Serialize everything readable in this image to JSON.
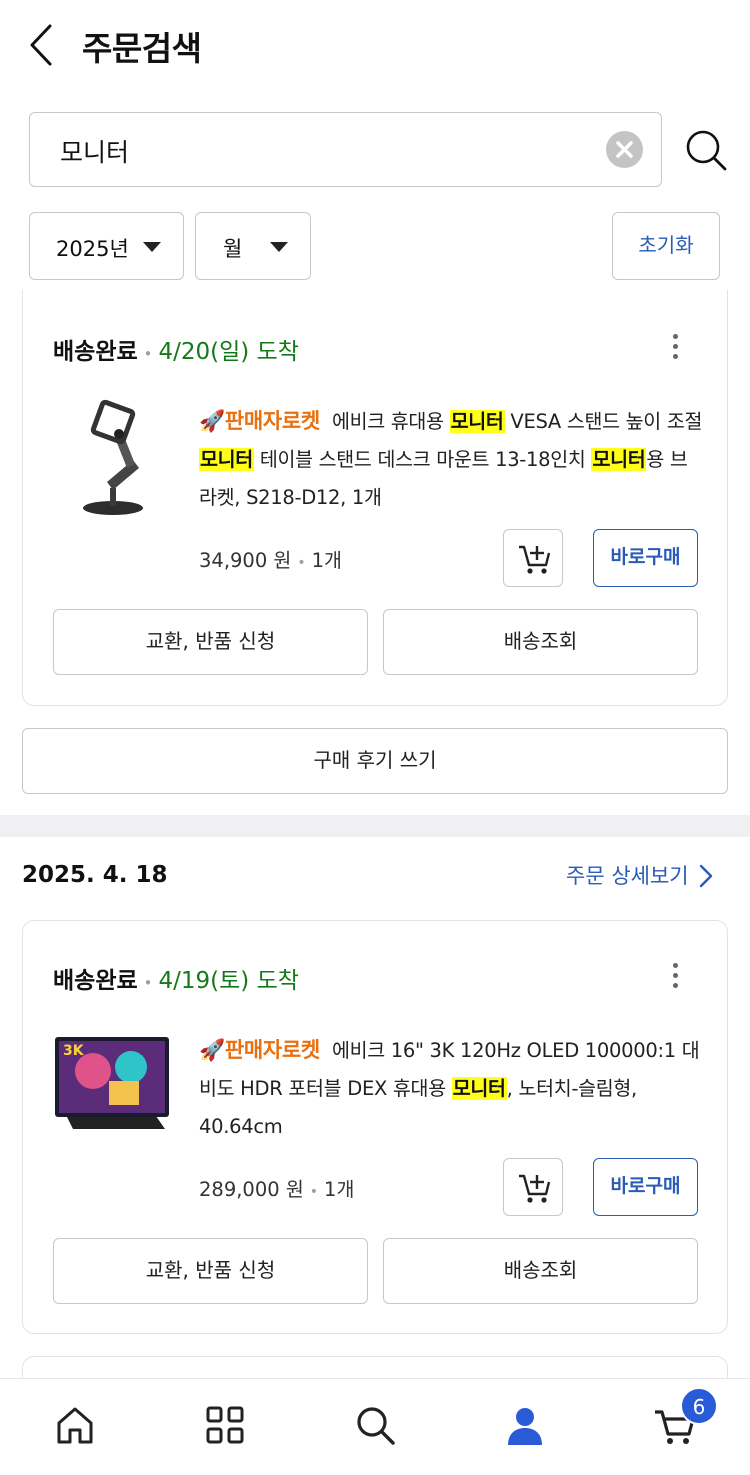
{
  "header": {
    "title": "주문검색",
    "back_icon": "chevron-left-icon"
  },
  "search": {
    "value": "모니터",
    "clear_icon": "clear-x-icon",
    "search_icon": "search-icon"
  },
  "filters": {
    "year": "2025년",
    "month": "월",
    "reset": "초기화"
  },
  "orders": [
    {
      "status": "배송완료",
      "arrival": "4/20(일) 도착",
      "seller_badge": "🚀판매자로켓",
      "desc": {
        "t1": "에비크 휴대용 ",
        "h1": "모니터",
        "t2": " VESA 스탠드 높이 조절 ",
        "h2": "모니터",
        "t3": " 테이블 스탠드 데스크 마운트 13-18인치 ",
        "h3": "모니터",
        "t4": "용 브라켓, S218-D12, 1개"
      },
      "price": "34,900 원",
      "qty": "1개",
      "buy_label": "바로구매",
      "exchange_label": "교환, 반품 신청",
      "tracking_label": "배송조회",
      "review_label": "구매 후기 쓰기"
    },
    {
      "date": "2025. 4. 18",
      "detail_link": "주문 상세보기",
      "status": "배송완료",
      "arrival": "4/19(토) 도착",
      "seller_badge": "🚀판매자로켓",
      "desc": {
        "t1": "에비크 16\" 3K 120Hz OLED 100000:1 대비도 HDR 포터블 DEX 휴대용 ",
        "h1": "모니터",
        "t2": ", 노터치-슬림형, 40.64cm"
      },
      "price": "289,000 원",
      "qty": "1개",
      "buy_label": "바로구매",
      "exchange_label": "교환, 반품 신청",
      "tracking_label": "배송조회"
    }
  ],
  "bottom_nav": {
    "items": [
      "home-icon",
      "category-grid-icon",
      "search-icon",
      "my-account-icon",
      "cart-icon"
    ],
    "active": "my-account-icon",
    "cart_badge": "6"
  },
  "colors": {
    "accent_blue": "#2a5bb5",
    "arrival_green": "#147a19",
    "rocket_orange": "#e8700f",
    "highlight": "#ffff1a"
  }
}
